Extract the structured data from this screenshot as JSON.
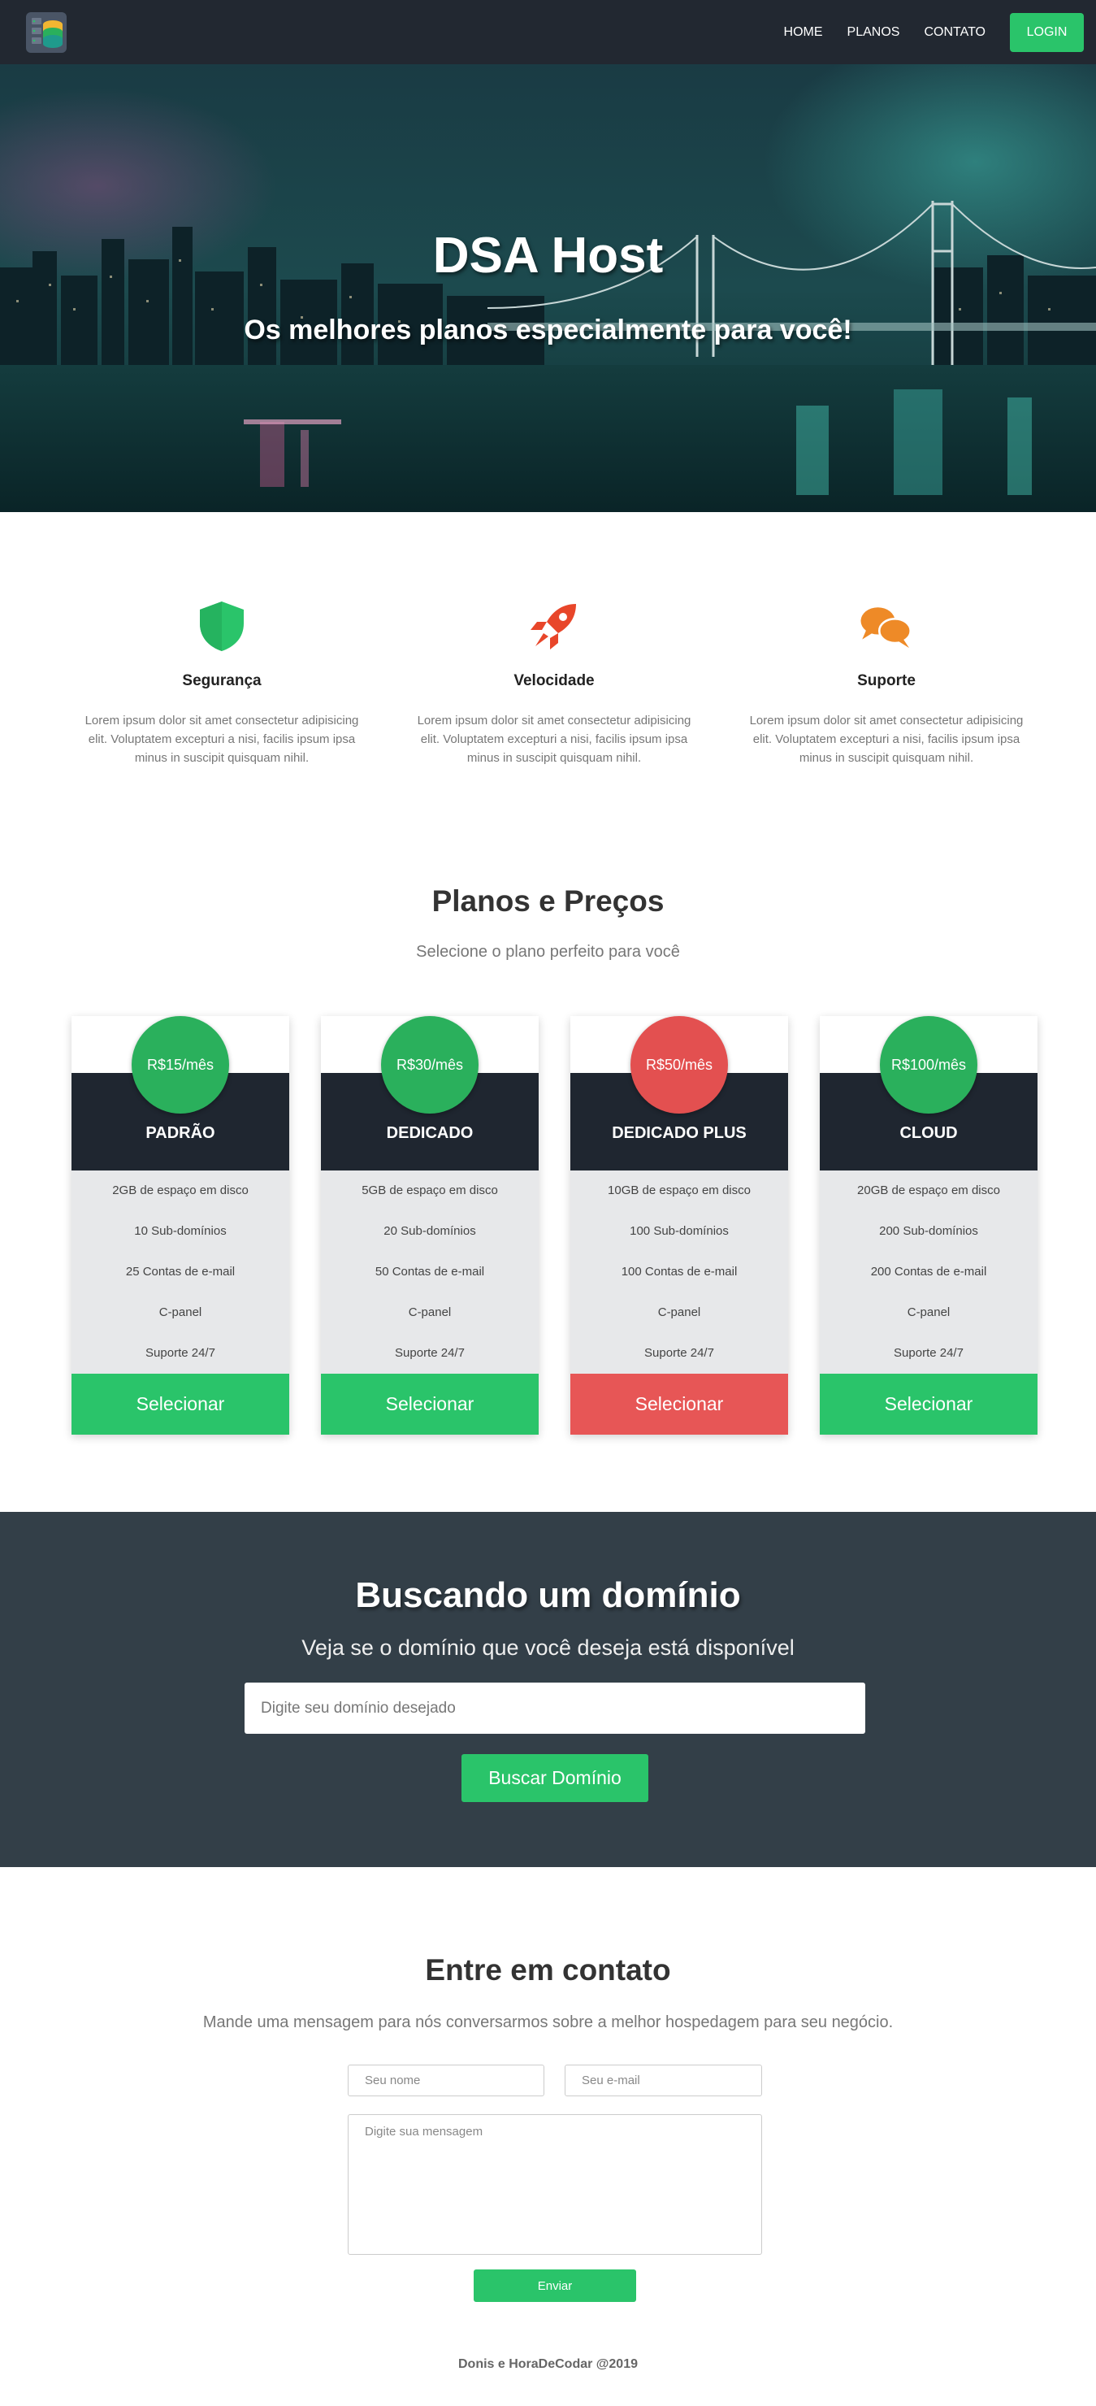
{
  "navbar": {
    "links": [
      {
        "label": "HOME"
      },
      {
        "label": "PLANOS"
      },
      {
        "label": "CONTATO"
      }
    ],
    "login_label": "LOGIN",
    "logo_icon": "database-server-icon"
  },
  "hero": {
    "title": "DSA Host",
    "subtitle": "Os melhores planos especialmente para você!"
  },
  "features": [
    {
      "icon": "shield-icon",
      "title": "Segurança",
      "text": "Lorem ipsum dolor sit amet consectetur adipisicing elit. Voluptatem excepturi a nisi, facilis ipsum ipsa minus in suscipit quisquam nihil.",
      "color": "#2ac46a"
    },
    {
      "icon": "rocket-icon",
      "title": "Velocidade",
      "text": "Lorem ipsum dolor sit amet consectetur adipisicing elit. Voluptatem excepturi a nisi, facilis ipsum ipsa minus in suscipit quisquam nihil.",
      "color": "#e8462a"
    },
    {
      "icon": "chat-bubbles-icon",
      "title": "Suporte",
      "text": "Lorem ipsum dolor sit amet consectetur adipisicing elit. Voluptatem excepturi a nisi, facilis ipsum ipsa minus in suscipit quisquam nihil.",
      "color": "#ee8a27"
    }
  ],
  "pricing": {
    "title": "Planos e Preços",
    "subtitle": "Selecione o plano perfeito para você",
    "plans": [
      {
        "price": "R$15/mês",
        "name": "PADRÃO",
        "items": [
          "2GB de espaço em disco",
          "10 Sub-domínios",
          "25 Contas de e-mail",
          "C-panel",
          "Suporte 24/7"
        ],
        "button": "Selecionar"
      },
      {
        "price": "R$30/mês",
        "name": "DEDICADO",
        "items": [
          "5GB de espaço em disco",
          "20 Sub-domínios",
          "50 Contas de e-mail",
          "C-panel",
          "Suporte 24/7"
        ],
        "button": "Selecionar"
      },
      {
        "price": "R$50/mês",
        "name": "DEDICADO PLUS",
        "items": [
          "10GB de espaço em disco",
          "100 Sub-domínios",
          "100 Contas de e-mail",
          "C-panel",
          "Suporte 24/7"
        ],
        "button": "Selecionar"
      },
      {
        "price": "R$100/mês",
        "name": "CLOUD",
        "items": [
          "20GB de espaço em disco",
          "200 Sub-domínios",
          "200 Contas de e-mail",
          "C-panel",
          "Suporte 24/7"
        ],
        "button": "Selecionar"
      }
    ]
  },
  "domain": {
    "title": "Buscando um domínio",
    "subtitle": "Veja se o domínio que você deseja está disponível",
    "placeholder": "Digite seu domínio desejado",
    "button": "Buscar Domínio"
  },
  "contact": {
    "title": "Entre em contato",
    "subtitle": "Mande uma mensagem para nós conversarmos sobre a melhor hospedagem para seu negócio.",
    "name_placeholder": "Seu nome",
    "email_placeholder": "Seu e-mail",
    "message_placeholder": "Digite sua mensagem",
    "send_label": "Enviar"
  },
  "footer": {
    "text": "Donis e HoraDeCodar @2019"
  },
  "colors": {
    "accent_green": "#2ac46a",
    "accent_red": "#e35050",
    "navbar_bg": "#222831",
    "domain_bg": "#333f48"
  }
}
